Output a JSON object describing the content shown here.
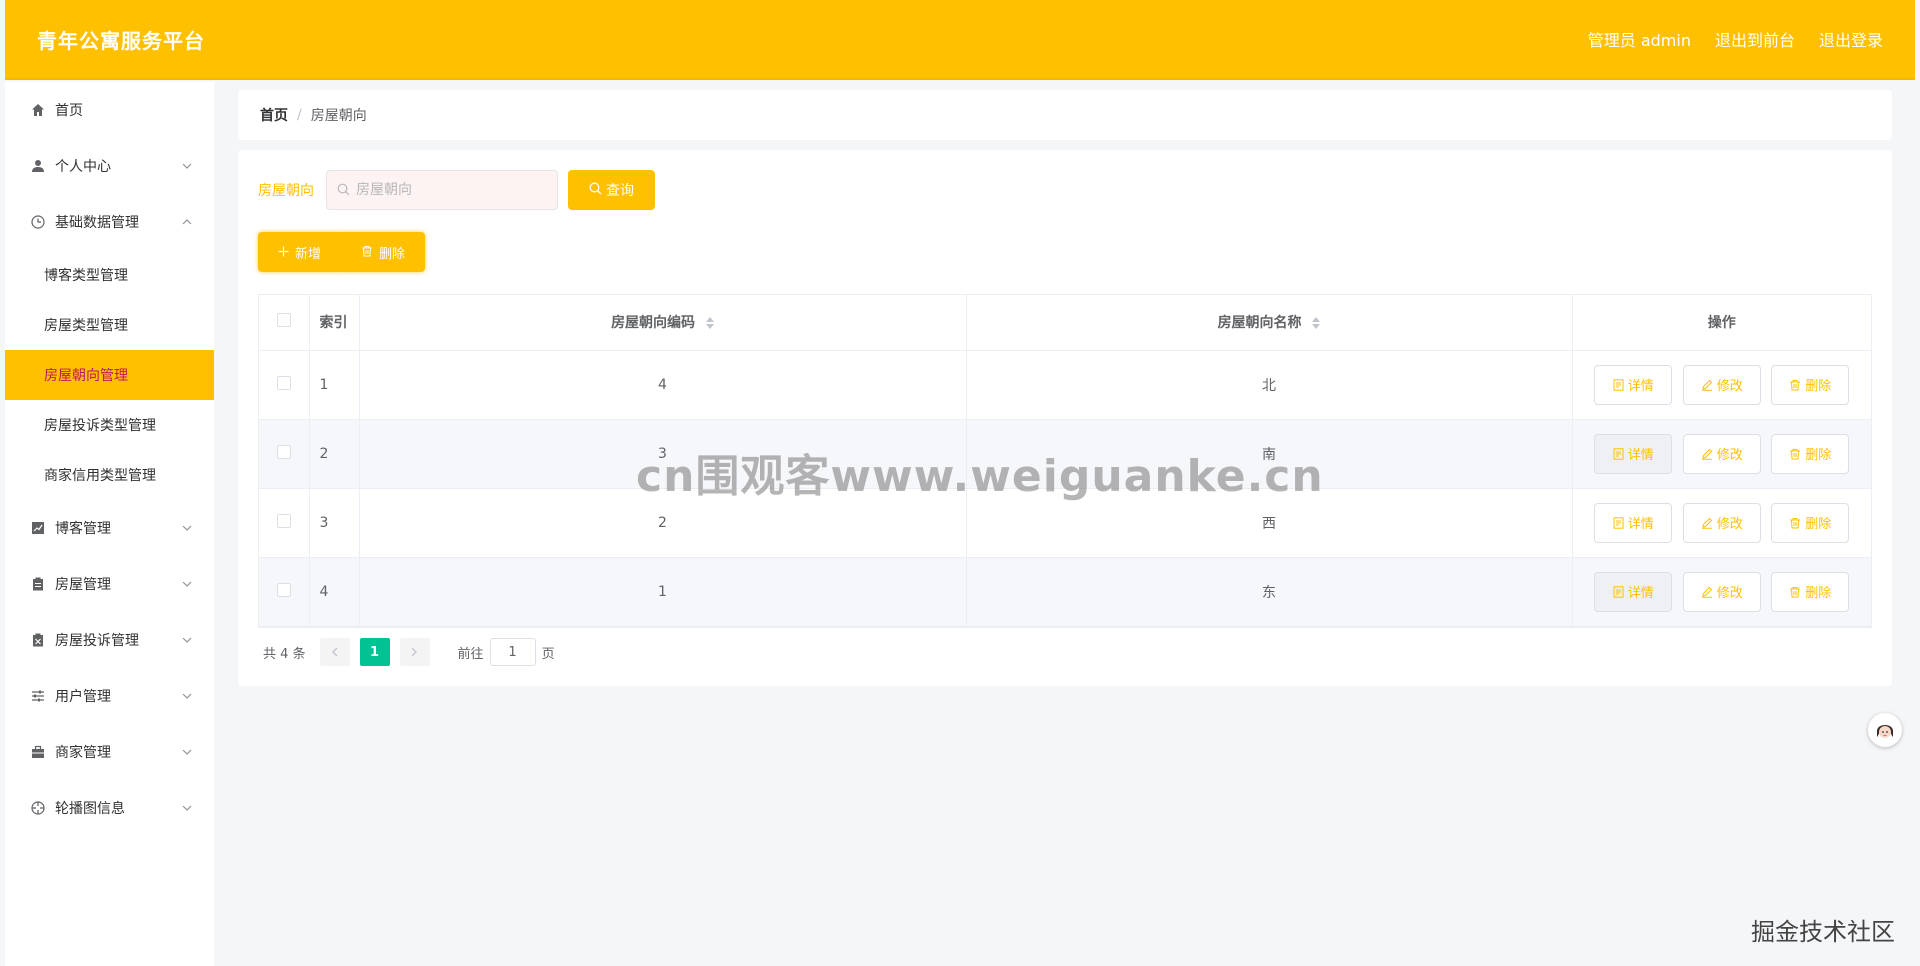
{
  "header": {
    "brand": "青年公寓服务平台",
    "user_label": "管理员 admin",
    "to_front": "退出到前台",
    "logout": "退出登录"
  },
  "sidebar": {
    "home": "首页",
    "personal": "个人中心",
    "base_data": "基础数据管理",
    "sub_items": [
      "博客类型管理",
      "房屋类型管理",
      "房屋朝向管理",
      "房屋投诉类型管理",
      "商家信用类型管理"
    ],
    "blog": "博客管理",
    "house": "房屋管理",
    "complaint": "房屋投诉管理",
    "user": "用户管理",
    "merchant": "商家管理",
    "carousel": "轮播图信息"
  },
  "breadcrumb": {
    "home": "首页",
    "sep": "/",
    "current": "房屋朝向"
  },
  "search": {
    "label": "房屋朝向",
    "placeholder": "房屋朝向",
    "query_label": "查询"
  },
  "actions": {
    "add": "新增",
    "delete": "删除"
  },
  "table": {
    "headers": {
      "index": "索引",
      "code": "房屋朝向编码",
      "name": "房屋朝向名称",
      "ops": "操作"
    },
    "rows": [
      {
        "index": "1",
        "code": "4",
        "name": "北"
      },
      {
        "index": "2",
        "code": "3",
        "name": "南"
      },
      {
        "index": "3",
        "code": "2",
        "name": "西"
      },
      {
        "index": "4",
        "code": "1",
        "name": "东"
      }
    ],
    "op_labels": {
      "detail": "详情",
      "edit": "修改",
      "delete": "删除"
    }
  },
  "pagination": {
    "total": "共 4 条",
    "current_page": "1",
    "goto_prefix": "前往",
    "goto_value": "1",
    "goto_suffix": "页"
  },
  "overlays": {
    "watermark": "cn围观客www.weiguanke.cn",
    "corner_mark": "掘金技术社区"
  },
  "colors": {
    "accent": "#ffc000",
    "pager_active": "#00c292",
    "active_text": "#c2185b"
  }
}
